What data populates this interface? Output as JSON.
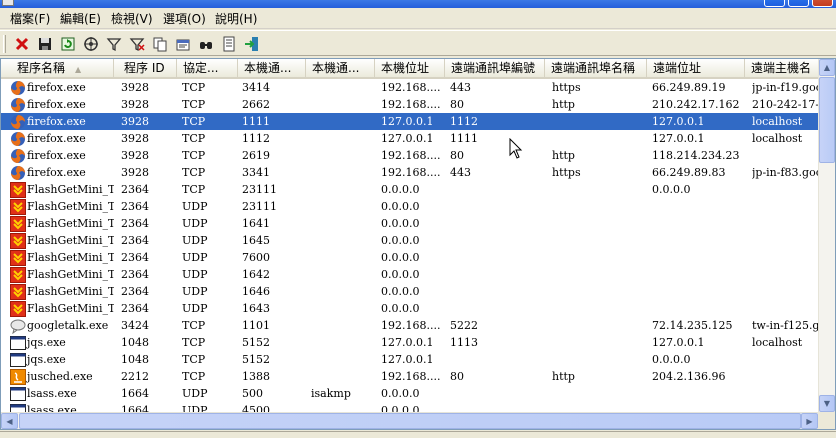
{
  "menu": [
    {
      "label": "檔案(F)"
    },
    {
      "label": "編輯(E)"
    },
    {
      "label": "檢視(V)"
    },
    {
      "label": "選項(O)"
    },
    {
      "label": "說明(H)"
    }
  ],
  "toolbar": [
    {
      "name": "close-connection-icon"
    },
    {
      "name": "save-icon"
    },
    {
      "name": "refresh-icon"
    },
    {
      "name": "properties-icon"
    },
    {
      "name": "filter-icon"
    },
    {
      "name": "filter-remove-icon"
    },
    {
      "name": "copy-icon"
    },
    {
      "name": "options-icon"
    },
    {
      "name": "find-icon"
    },
    {
      "name": "report-icon"
    },
    {
      "name": "exit-icon"
    }
  ],
  "columns": [
    "程序名稱",
    "程序 ID",
    "協定...",
    "本機通...",
    "本機通...",
    "本機位址",
    "遠端通訊埠編號",
    "遠端通訊埠名稱",
    "遠端位址",
    "遠端主機名"
  ],
  "rows": [
    {
      "icon": "firefox",
      "cells": [
        "firefox.exe",
        "3928",
        "TCP",
        "3414",
        "",
        "192.168....",
        "443",
        "https",
        "66.249.89.19",
        "jp-in-f19.goo"
      ]
    },
    {
      "icon": "firefox",
      "cells": [
        "firefox.exe",
        "3928",
        "TCP",
        "2662",
        "",
        "192.168....",
        "80",
        "http",
        "210.242.17.162",
        "210-242-17-1"
      ]
    },
    {
      "icon": "firefox",
      "cells": [
        "firefox.exe",
        "3928",
        "TCP",
        "1111",
        "",
        "127.0.0.1",
        "1112",
        "",
        "127.0.0.1",
        "localhost"
      ],
      "selected": true
    },
    {
      "icon": "firefox",
      "cells": [
        "firefox.exe",
        "3928",
        "TCP",
        "1112",
        "",
        "127.0.0.1",
        "1111",
        "",
        "127.0.0.1",
        "localhost"
      ]
    },
    {
      "icon": "firefox",
      "cells": [
        "firefox.exe",
        "3928",
        "TCP",
        "2619",
        "",
        "192.168....",
        "80",
        "http",
        "118.214.234.23",
        ""
      ]
    },
    {
      "icon": "firefox",
      "cells": [
        "firefox.exe",
        "3928",
        "TCP",
        "3341",
        "",
        "192.168....",
        "443",
        "https",
        "66.249.89.83",
        "jp-in-f83.goo"
      ]
    },
    {
      "icon": "flashget",
      "cells": [
        "FlashGetMini_T...",
        "2364",
        "TCP",
        "23111",
        "",
        "0.0.0.0",
        "",
        "",
        "0.0.0.0",
        ""
      ]
    },
    {
      "icon": "flashget",
      "cells": [
        "FlashGetMini_T...",
        "2364",
        "UDP",
        "23111",
        "",
        "0.0.0.0",
        "",
        "",
        "",
        ""
      ]
    },
    {
      "icon": "flashget",
      "cells": [
        "FlashGetMini_T...",
        "2364",
        "UDP",
        "1641",
        "",
        "0.0.0.0",
        "",
        "",
        "",
        ""
      ]
    },
    {
      "icon": "flashget",
      "cells": [
        "FlashGetMini_T...",
        "2364",
        "UDP",
        "1645",
        "",
        "0.0.0.0",
        "",
        "",
        "",
        ""
      ]
    },
    {
      "icon": "flashget",
      "cells": [
        "FlashGetMini_T...",
        "2364",
        "UDP",
        "7600",
        "",
        "0.0.0.0",
        "",
        "",
        "",
        ""
      ]
    },
    {
      "icon": "flashget",
      "cells": [
        "FlashGetMini_T...",
        "2364",
        "UDP",
        "1642",
        "",
        "0.0.0.0",
        "",
        "",
        "",
        ""
      ]
    },
    {
      "icon": "flashget",
      "cells": [
        "FlashGetMini_T...",
        "2364",
        "UDP",
        "1646",
        "",
        "0.0.0.0",
        "",
        "",
        "",
        ""
      ]
    },
    {
      "icon": "flashget",
      "cells": [
        "FlashGetMini_T...",
        "2364",
        "UDP",
        "1643",
        "",
        "0.0.0.0",
        "",
        "",
        "",
        ""
      ]
    },
    {
      "icon": "googletalk",
      "cells": [
        "googletalk.exe",
        "3424",
        "TCP",
        "1101",
        "",
        "192.168....",
        "5222",
        "",
        "72.14.235.125",
        "tw-in-f125.go"
      ]
    },
    {
      "icon": "window",
      "cells": [
        "jqs.exe",
        "1048",
        "TCP",
        "5152",
        "",
        "127.0.0.1",
        "1113",
        "",
        "127.0.0.1",
        "localhost"
      ]
    },
    {
      "icon": "window",
      "cells": [
        "jqs.exe",
        "1048",
        "TCP",
        "5152",
        "",
        "127.0.0.1",
        "",
        "",
        "0.0.0.0",
        ""
      ]
    },
    {
      "icon": "java",
      "cells": [
        "jusched.exe",
        "2212",
        "TCP",
        "1388",
        "",
        "192.168....",
        "80",
        "http",
        "204.2.136.96",
        ""
      ]
    },
    {
      "icon": "window",
      "cells": [
        "lsass.exe",
        "1664",
        "UDP",
        "500",
        "isakmp",
        "0.0.0.0",
        "",
        "",
        "",
        ""
      ]
    },
    {
      "icon": "window",
      "cells": [
        "lsass.exe",
        "1664",
        "UDP",
        "4500",
        "",
        "0.0.0.0",
        "",
        "",
        "",
        ""
      ]
    }
  ],
  "colors": {
    "selection": "#316ac5",
    "grid_bg": "#ffffff",
    "chrome": "#ece9d8"
  }
}
